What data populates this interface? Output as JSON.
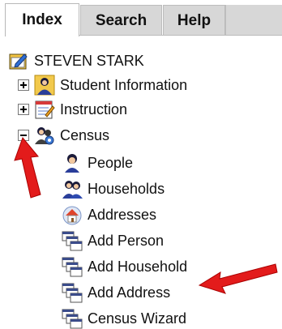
{
  "tabs": {
    "index": "Index",
    "search": "Search",
    "help": "Help"
  },
  "tree": {
    "root": "STEVEN STARK",
    "student_information": "Student Information",
    "instruction": "Instruction",
    "census": "Census",
    "people": "People",
    "households": "Households",
    "addresses": "Addresses",
    "add_person": "Add Person",
    "add_household": "Add Household",
    "add_address": "Add Address",
    "census_wizard": "Census Wizard"
  },
  "colors": {
    "arrow": "#e31b1b",
    "tab_bg": "#d7d7d7"
  },
  "icons": {
    "root": "edit-folder-icon",
    "student_information": "person-icon",
    "instruction": "notepad-icon",
    "census": "people-gear-icon",
    "people": "person-icon",
    "households": "people-icon",
    "addresses": "house-icon",
    "tool": "windows-stack-icon"
  }
}
